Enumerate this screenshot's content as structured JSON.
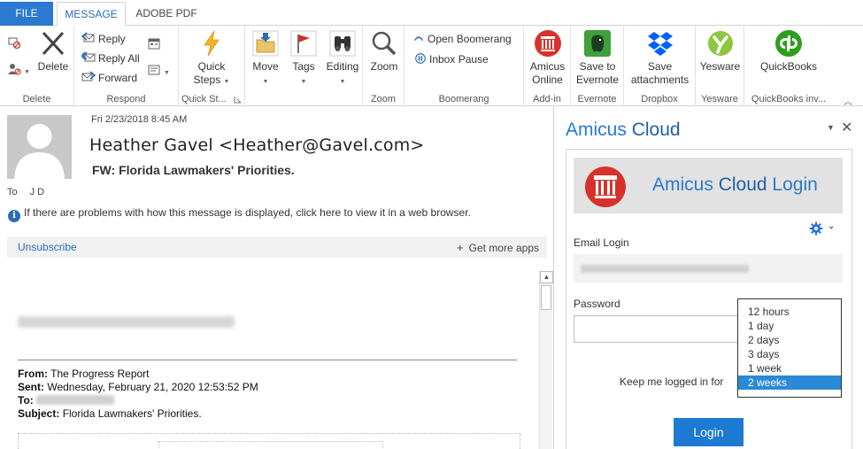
{
  "tabs": {
    "file": "FILE",
    "message": "MESSAGE",
    "adobe_pdf": "ADOBE PDF"
  },
  "ribbon": {
    "delete": {
      "delete_label": "Delete",
      "group": "Delete"
    },
    "respond": {
      "reply": "Reply",
      "reply_all": "Reply All",
      "forward": "Forward",
      "group": "Respond"
    },
    "quick_steps": {
      "label_line1": "Quick",
      "label_line2": "Steps",
      "group": "Quick St..."
    },
    "move": {
      "label": "Move"
    },
    "tags": {
      "label": "Tags"
    },
    "editing": {
      "label": "Editing"
    },
    "zoom": {
      "label": "Zoom",
      "group": "Zoom"
    },
    "boomerang": {
      "open": "Open Boomerang",
      "pause": "Inbox Pause",
      "group": "Boomerang"
    },
    "addin": {
      "line1": "Amicus",
      "line2": "Online",
      "group": "Add-in"
    },
    "evernote": {
      "line1": "Save to",
      "line2": "Evernote",
      "group": "Evernote"
    },
    "dropbox": {
      "line1": "Save",
      "line2": "attachments",
      "group": "Dropbox"
    },
    "yesware": {
      "label": "Yesware",
      "group": "Yesware"
    },
    "quickbooks": {
      "label": "QuickBooks",
      "group": "QuickBooks inv..."
    }
  },
  "message": {
    "date": "Fri 2/23/2018 8:45 AM",
    "sender": "Heather Gavel <Heather@Gavel.com>",
    "subject": "FW: Florida Lawmakers' Priorities.",
    "to_label": "To",
    "to_value": "J D",
    "info": "If there are problems with how this message is displayed, click here to view it in a web browser.",
    "unsubscribe": "Unsubscribe",
    "get_more_apps": "Get more apps",
    "headers": {
      "from_label": "From:",
      "from_value": "The Progress Report",
      "sent_label": "Sent:",
      "sent_value": "Wednesday, February 21, 2020 12:53:52 PM",
      "to_label": "To:",
      "subject_label": "Subject:",
      "subject_value": "Florida Lawmakers' Priorities."
    }
  },
  "pane": {
    "title_part1": "Amicus",
    "title_part2": "Cloud",
    "login_head_part1": "Amicus",
    "login_head_part2": "Cloud",
    "login_head_part3": "Login",
    "email_label": "Email Login",
    "password_label": "Password",
    "keep_logged_label": "Keep me logged in for",
    "options": [
      "12 hours",
      "1 day",
      "2 days",
      "3 days",
      "1 week",
      "2 weeks"
    ],
    "selected_option": "2 weeks",
    "login_button": "Login"
  },
  "colors": {
    "accent": "#2b79d0",
    "file_tab": "#2b79d0",
    "login_button": "#1c7ad3",
    "dropdown_selected": "#2b8ad6"
  }
}
